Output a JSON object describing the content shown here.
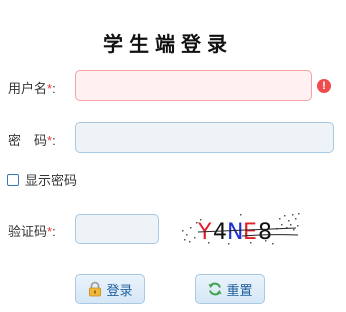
{
  "title": "学生端登录",
  "form": {
    "username": {
      "label": "用户名",
      "required_mark": "*",
      "colon": ":",
      "value": "",
      "has_error": true
    },
    "password": {
      "label": "密　码",
      "required_mark": "*",
      "colon": ":",
      "value": ""
    },
    "show_password": {
      "label": "显示密码",
      "checked": false
    },
    "captcha": {
      "label": "验证码",
      "required_mark": "*",
      "colon": ":",
      "value": "",
      "image_text": "Y4NE8"
    }
  },
  "buttons": {
    "login_label": "登录",
    "reset_label": "重置",
    "login_icon": "lock-icon",
    "reset_icon": "refresh-icon"
  },
  "colors": {
    "error": "#ee4d4d",
    "button_text": "#1f5f9e",
    "input_border": "#a9c8e2",
    "captcha_red": "#e0202a",
    "captcha_blue": "#1f2fd6"
  }
}
